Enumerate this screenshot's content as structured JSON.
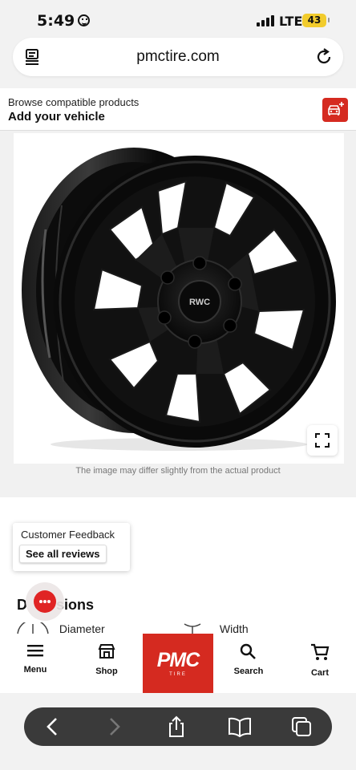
{
  "status": {
    "time": "5:49",
    "network": "LTE",
    "battery": "43"
  },
  "browser": {
    "url": "pmctire.com"
  },
  "vehicle": {
    "subtitle": "Browse compatible products",
    "title": "Add your vehicle"
  },
  "product": {
    "image_disclaimer": "The image may differ slightly from the actual product",
    "wheel_logo": "RWC"
  },
  "feedback": {
    "title": "Customer Feedback",
    "button": "See all reviews"
  },
  "dimensions": {
    "title_start": "D",
    "title_end": "sions",
    "diameter": "Diameter",
    "width": "Width"
  },
  "nav": {
    "menu": "Menu",
    "shop": "Shop",
    "search": "Search",
    "cart": "Cart",
    "logo_main": "PMC",
    "logo_sub": "TIRE"
  },
  "colors": {
    "brand_red": "#d52a20",
    "toolbar": "#3a3a3a"
  }
}
